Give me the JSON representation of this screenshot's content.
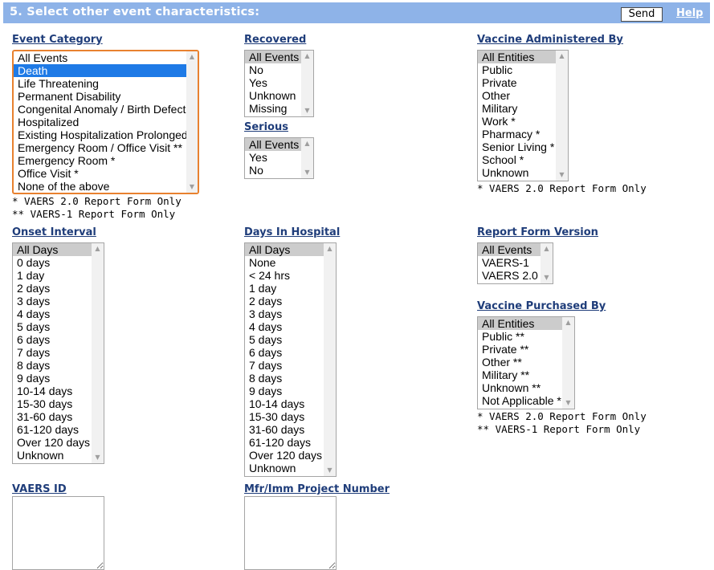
{
  "header": {
    "title": "5. Select other event characteristics:",
    "send_label": "Send",
    "help_label": "Help"
  },
  "event_category": {
    "label": "Event Category",
    "options": [
      "All Events",
      "Death",
      "Life Threatening",
      "Permanent Disability",
      "Congenital Anomaly / Birth Defect *",
      "Hospitalized",
      "Existing Hospitalization Prolonged",
      "Emergency Room / Office Visit **",
      "Emergency Room *",
      "Office Visit *",
      "None of the above"
    ],
    "selected": "Death",
    "footnote_1": "* VAERS 2.0 Report Form Only",
    "footnote_2": "** VAERS-1 Report Form Only"
  },
  "recovered": {
    "label": "Recovered",
    "options": [
      "All Events",
      "No",
      "Yes",
      "Unknown",
      "Missing"
    ],
    "selected": "All Events"
  },
  "serious": {
    "label": "Serious",
    "options": [
      "All Events",
      "Yes",
      "No"
    ],
    "selected": "All Events"
  },
  "vaccine_administered_by": {
    "label": "Vaccine Administered By",
    "options": [
      "All Entities",
      "Public",
      "Private",
      "Other",
      "Military",
      "Work *",
      "Pharmacy *",
      "Senior Living *",
      "School *",
      "Unknown"
    ],
    "selected": "All Entities",
    "footnote": "* VAERS 2.0 Report Form Only"
  },
  "onset_interval": {
    "label": "Onset Interval",
    "options": [
      "All Days",
      "0 days",
      "1 day",
      "2 days",
      "3 days",
      "4 days",
      "5 days",
      "6 days",
      "7 days",
      "8 days",
      "9 days",
      "10-14 days",
      "15-30 days",
      "31-60 days",
      "61-120 days",
      "Over 120 days",
      "Unknown"
    ],
    "selected": "All Days"
  },
  "days_in_hospital": {
    "label": "Days In Hospital",
    "options": [
      "All Days",
      "None",
      "< 24 hrs",
      "1 day",
      "2 days",
      "3 days",
      "4 days",
      "5 days",
      "6 days",
      "7 days",
      "8 days",
      "9 days",
      "10-14 days",
      "15-30 days",
      "31-60 days",
      "61-120 days",
      "Over 120 days",
      "Unknown"
    ],
    "selected": "All Days"
  },
  "report_form_version": {
    "label": "Report Form Version",
    "options": [
      "All Events",
      "VAERS-1",
      "VAERS 2.0"
    ],
    "selected": "All Events"
  },
  "vaccine_purchased_by": {
    "label": "Vaccine Purchased By",
    "options": [
      "All Entities",
      "Public **",
      "Private **",
      "Other **",
      "Military **",
      "Unknown **",
      "Not Applicable *"
    ],
    "selected": "All Entities",
    "footnote_1": "* VAERS 2.0 Report Form Only",
    "footnote_2": "** VAERS-1 Report Form Only"
  },
  "vaers_id": {
    "label": "VAERS ID",
    "value": ""
  },
  "mfr_project": {
    "label": "Mfr/Imm Project Number",
    "value": ""
  },
  "colors": {
    "header_bg": "#8eb3e8",
    "label_link": "#1f3d7a",
    "selected_blue": "#1e7ae6",
    "selected_grey": "#cccccc",
    "focus_border": "#e8812f"
  }
}
